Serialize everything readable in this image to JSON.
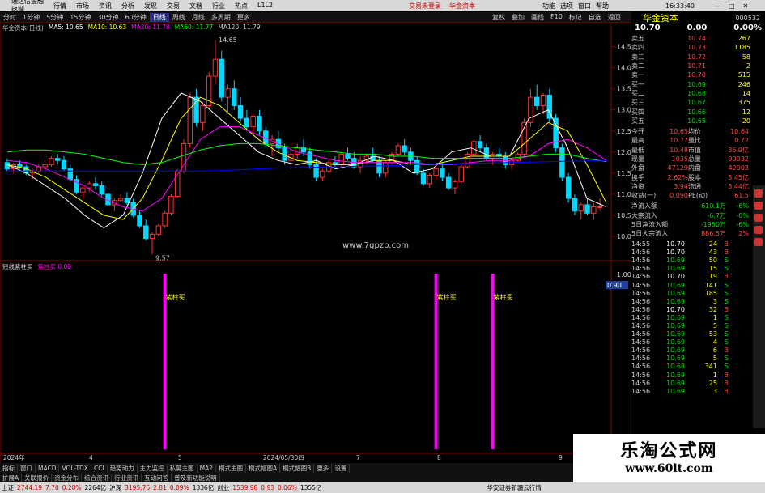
{
  "title_bar": {
    "app_name": "通达信金融终端",
    "menu": [
      "行情",
      "市场",
      "资讯",
      "分析",
      "发现",
      "交易",
      "文档",
      "行业",
      "热点",
      "L1L2"
    ],
    "center_links": [
      "交易未登录",
      "华金资本"
    ],
    "right_items": [
      "功能",
      "选项",
      "窗口",
      "帮助"
    ],
    "time": "16:33:40"
  },
  "toolbar": {
    "periods": [
      "分时",
      "1分钟",
      "5分钟",
      "15分钟",
      "30分钟",
      "60分钟",
      "日线",
      "周线",
      "月线",
      "多周期",
      "更多"
    ],
    "active_period": "日线",
    "right_buttons": [
      "复权",
      "叠加",
      "画线",
      "F10",
      "标记",
      "自选",
      "返回"
    ]
  },
  "main_chart": {
    "title": "华金资本(日线)",
    "ma_labels": [
      {
        "text": "MA5: 10.65",
        "color": "#ffffff"
      },
      {
        "text": "MA10: 10.63",
        "color": "#ffff00"
      },
      {
        "text": "MA20: 11.78",
        "color": "#ff00ff"
      },
      {
        "text": "MA60: 11.77",
        "color": "#00ff00"
      },
      {
        "text": "MA120: 11.79",
        "color": "#cccccc"
      }
    ],
    "price_axis": [
      "14.50",
      "14.00",
      "13.50",
      "13.00",
      "12.50",
      "12.00",
      "11.50",
      "11.00",
      "10.50",
      "10.00"
    ],
    "high_label": "14.65",
    "low_label": "9.57",
    "site_watermark": "www.7gpzb.com"
  },
  "chart_data": {
    "type": "candlestick",
    "ylim": [
      9.5,
      14.8
    ],
    "candles": [
      [
        11.75,
        11.85,
        11.55,
        11.6
      ],
      [
        11.6,
        11.75,
        11.5,
        11.7
      ],
      [
        11.7,
        11.8,
        11.6,
        11.65
      ],
      [
        11.65,
        11.7,
        11.45,
        11.5
      ],
      [
        11.5,
        11.6,
        11.35,
        11.55
      ],
      [
        11.55,
        11.7,
        11.5,
        11.65
      ],
      [
        11.65,
        11.8,
        11.6,
        11.7
      ],
      [
        11.7,
        11.9,
        11.65,
        11.85
      ],
      [
        11.85,
        11.95,
        11.7,
        11.8
      ],
      [
        11.8,
        11.9,
        11.55,
        11.6
      ],
      [
        11.6,
        11.7,
        11.3,
        11.35
      ],
      [
        11.35,
        11.45,
        11.0,
        11.05
      ],
      [
        11.05,
        11.2,
        10.9,
        11.15
      ],
      [
        11.15,
        11.3,
        11.05,
        11.25
      ],
      [
        11.25,
        11.4,
        11.1,
        11.2
      ],
      [
        11.2,
        11.3,
        10.95,
        11.0
      ],
      [
        11.0,
        11.1,
        10.7,
        10.75
      ],
      [
        10.75,
        10.9,
        10.6,
        10.85
      ],
      [
        10.85,
        11.0,
        10.8,
        10.9
      ],
      [
        10.9,
        11.05,
        10.75,
        10.8
      ],
      [
        10.8,
        10.9,
        10.45,
        10.5
      ],
      [
        10.5,
        10.6,
        10.2,
        10.25
      ],
      [
        10.25,
        10.4,
        9.9,
        9.95
      ],
      [
        9.95,
        10.1,
        9.57,
        10.05
      ],
      [
        10.05,
        10.3,
        10.0,
        10.25
      ],
      [
        10.25,
        10.6,
        10.2,
        10.55
      ],
      [
        10.55,
        11.0,
        10.5,
        10.95
      ],
      [
        10.95,
        11.6,
        10.9,
        11.55
      ],
      [
        11.55,
        12.3,
        11.5,
        12.2
      ],
      [
        12.2,
        13.4,
        12.1,
        13.3
      ],
      [
        13.3,
        13.5,
        12.6,
        12.7
      ],
      [
        12.7,
        13.2,
        12.5,
        13.1
      ],
      [
        13.1,
        13.9,
        13.0,
        13.8
      ],
      [
        13.8,
        14.65,
        13.6,
        14.2
      ],
      [
        14.2,
        14.4,
        13.2,
        13.3
      ],
      [
        13.3,
        13.6,
        12.9,
        13.5
      ],
      [
        13.5,
        13.7,
        13.0,
        13.1
      ],
      [
        13.1,
        13.3,
        12.7,
        12.8
      ],
      [
        12.8,
        13.0,
        12.5,
        12.6
      ],
      [
        12.6,
        12.9,
        12.4,
        12.85
      ],
      [
        12.85,
        13.0,
        12.4,
        12.5
      ],
      [
        12.5,
        12.6,
        12.1,
        12.2
      ],
      [
        12.2,
        12.4,
        11.9,
        12.3
      ],
      [
        12.3,
        12.5,
        12.0,
        12.1
      ],
      [
        12.1,
        12.2,
        11.7,
        11.8
      ],
      [
        11.8,
        12.0,
        11.6,
        11.95
      ],
      [
        11.95,
        12.2,
        11.85,
        12.1
      ],
      [
        12.1,
        12.3,
        11.9,
        12.0
      ],
      [
        12.0,
        12.1,
        11.6,
        11.7
      ],
      [
        11.7,
        11.85,
        11.3,
        11.4
      ],
      [
        11.4,
        11.6,
        11.3,
        11.55
      ],
      [
        11.55,
        11.8,
        11.5,
        11.75
      ],
      [
        11.75,
        11.9,
        11.6,
        11.7
      ],
      [
        11.7,
        12.0,
        11.65,
        11.95
      ],
      [
        11.95,
        12.1,
        11.8,
        11.85
      ],
      [
        11.85,
        12.0,
        11.6,
        11.65
      ],
      [
        11.65,
        11.9,
        11.5,
        11.8
      ],
      [
        11.8,
        11.95,
        11.7,
        11.9
      ],
      [
        11.9,
        12.1,
        11.75,
        11.8
      ],
      [
        11.8,
        11.9,
        11.4,
        11.5
      ],
      [
        11.5,
        11.8,
        11.4,
        11.75
      ],
      [
        11.75,
        12.0,
        11.7,
        11.95
      ],
      [
        11.95,
        12.2,
        11.9,
        12.15
      ],
      [
        12.15,
        12.3,
        11.9,
        12.0
      ],
      [
        12.0,
        12.1,
        11.7,
        11.8
      ],
      [
        11.8,
        11.9,
        11.45,
        11.5
      ],
      [
        11.5,
        11.6,
        11.2,
        11.25
      ],
      [
        11.25,
        11.5,
        11.15,
        11.45
      ],
      [
        11.45,
        11.7,
        11.35,
        11.6
      ],
      [
        11.6,
        11.75,
        11.3,
        11.4
      ],
      [
        11.4,
        11.5,
        11.1,
        11.15
      ],
      [
        11.15,
        11.35,
        11.0,
        11.3
      ],
      [
        11.3,
        11.7,
        11.25,
        11.65
      ],
      [
        11.65,
        12.0,
        11.6,
        11.95
      ],
      [
        11.95,
        12.3,
        11.9,
        12.25
      ],
      [
        12.25,
        12.4,
        12.0,
        12.1
      ],
      [
        12.1,
        12.2,
        11.8,
        11.85
      ],
      [
        11.85,
        12.0,
        11.7,
        11.95
      ],
      [
        11.95,
        12.1,
        11.8,
        11.9
      ],
      [
        11.9,
        12.0,
        11.6,
        11.7
      ],
      [
        11.7,
        11.85,
        11.6,
        11.8
      ],
      [
        11.8,
        12.0,
        11.75,
        11.95
      ],
      [
        11.95,
        12.8,
        11.9,
        12.7
      ],
      [
        12.7,
        13.5,
        12.6,
        13.3
      ],
      [
        13.3,
        13.6,
        13.0,
        13.1
      ],
      [
        13.1,
        13.4,
        12.9,
        13.35
      ],
      [
        13.35,
        13.5,
        12.7,
        12.8
      ],
      [
        12.8,
        12.9,
        12.0,
        12.1
      ],
      [
        12.1,
        12.2,
        11.3,
        11.4
      ],
      [
        11.4,
        11.5,
        10.8,
        10.9
      ],
      [
        10.9,
        11.0,
        10.5,
        10.6
      ],
      [
        10.6,
        10.8,
        10.4,
        10.75
      ],
      [
        10.75,
        10.9,
        10.5,
        10.55
      ],
      [
        10.55,
        10.8,
        10.4,
        10.7
      ],
      [
        10.7,
        10.9,
        10.6,
        10.7
      ]
    ],
    "ma_series": [
      {
        "name": "MA5",
        "color": "#ffffff",
        "values": [
          11.7,
          11.5,
          11.2,
          10.9,
          10.5,
          10.2,
          10.5,
          11.5,
          12.8,
          13.4,
          13.2,
          12.8,
          12.4,
          12.0,
          11.8,
          11.7,
          11.8,
          11.6,
          11.7,
          11.9,
          11.8,
          11.5,
          11.6,
          12.0,
          12.1,
          11.9,
          11.9,
          12.8,
          13.0,
          12.1,
          10.9,
          10.7
        ]
      },
      {
        "name": "MA10",
        "color": "#ffff00",
        "values": [
          11.7,
          11.6,
          11.4,
          11.1,
          10.8,
          10.5,
          10.4,
          10.9,
          11.8,
          12.8,
          13.3,
          13.1,
          12.7,
          12.3,
          12.0,
          11.8,
          11.75,
          11.7,
          11.7,
          11.8,
          11.8,
          11.7,
          11.7,
          11.8,
          11.9,
          11.9,
          11.9,
          12.3,
          12.7,
          12.5,
          11.7,
          10.8
        ]
      },
      {
        "name": "MA20",
        "color": "#ff00ff",
        "values": [
          11.8,
          11.75,
          11.6,
          11.4,
          11.2,
          10.9,
          10.7,
          10.6,
          10.9,
          11.6,
          12.3,
          12.6,
          12.6,
          12.4,
          12.2,
          12.0,
          11.9,
          11.8,
          11.75,
          11.75,
          11.75,
          11.75,
          11.7,
          11.7,
          11.75,
          11.8,
          11.8,
          11.9,
          12.2,
          12.3,
          12.1,
          11.8
        ]
      },
      {
        "name": "MA60",
        "color": "#00ff00",
        "values": [
          12.0,
          12.05,
          12.05,
          12.0,
          11.95,
          11.85,
          11.75,
          11.7,
          11.75,
          11.9,
          12.05,
          12.15,
          12.2,
          12.2,
          12.15,
          12.1,
          12.05,
          12.0,
          11.95,
          11.95,
          11.9,
          11.9,
          11.85,
          11.85,
          11.85,
          11.85,
          11.85,
          11.9,
          11.95,
          11.95,
          11.85,
          11.77
        ]
      },
      {
        "name": "MA120",
        "color": "#0000ff",
        "values": [
          11.55,
          11.55,
          11.55,
          11.55,
          11.55,
          11.55,
          11.55,
          11.55,
          11.55,
          11.55,
          11.55,
          11.56,
          11.58,
          11.6,
          11.62,
          11.63,
          11.64,
          11.65,
          11.66,
          11.67,
          11.68,
          11.7,
          11.71,
          11.72,
          11.73,
          11.74,
          11.75,
          11.76,
          11.77,
          11.78,
          11.79,
          11.79
        ]
      }
    ],
    "signal_bars_index": [
      25,
      68,
      77
    ]
  },
  "sub_chart": {
    "title": "短线紫柱买",
    "subtitle": "紫柱买 0.00",
    "bar_label": "紫柱买",
    "axis_top": "1.00",
    "axis_value": "0.90"
  },
  "date_axis": [
    "2024年",
    "4",
    "5",
    "2024/05/30四",
    "7",
    "8",
    "9"
  ],
  "bottom_tabs": [
    "指标",
    "窗口",
    "MACD",
    "VOL-TDX",
    "CCI",
    "趋势动力",
    "主力监控",
    "私募主图",
    "MA2",
    "桐式主图",
    "桐式幅图A",
    "桐式幅图B",
    "更多",
    "设置"
  ],
  "quote": {
    "name": "华金资本",
    "code": "000532",
    "price": "10.70",
    "change": "0.00",
    "pct": "0.00%",
    "asks": [
      [
        "卖五",
        "10.74",
        "267"
      ],
      [
        "卖四",
        "10.73",
        "1185"
      ],
      [
        "卖三",
        "10.72",
        "58"
      ],
      [
        "卖二",
        "10.71",
        "2"
      ],
      [
        "卖一",
        "10.70",
        "515"
      ]
    ],
    "bids": [
      [
        "买一",
        "10.69",
        "246"
      ],
      [
        "买二",
        "10.68",
        "14"
      ],
      [
        "买三",
        "10.67",
        "375"
      ],
      [
        "买四",
        "10.66",
        "12"
      ],
      [
        "买五",
        "10.65",
        "20"
      ]
    ],
    "stats": [
      [
        "今开",
        "10.65",
        "均价",
        "10.64"
      ],
      [
        "最高",
        "10.77",
        "量比",
        "0.72"
      ],
      [
        "最低",
        "10.49",
        "市值",
        "36.9亿"
      ],
      [
        "现量",
        "1035",
        "总量",
        "90032"
      ],
      [
        "外盘",
        "47129",
        "内盘",
        "42903"
      ],
      [
        "换手",
        "2.62%",
        "股本",
        "3.45亿"
      ],
      [
        "净资",
        "3.94",
        "流通",
        "3.44亿"
      ],
      [
        "收益(一)",
        "0.090",
        "PE(动)",
        "61.5"
      ]
    ],
    "flows": [
      [
        "净流入额",
        "-610.1万",
        "-6%"
      ],
      [
        "大宗流入",
        "-6.7万",
        "-0%"
      ],
      [
        "5日净流入额",
        "-1950万",
        "-6%"
      ],
      [
        "5日大宗流入",
        "886.5万",
        "2%"
      ]
    ],
    "ticks": [
      [
        "14:55",
        "10.70",
        "24",
        "B"
      ],
      [
        "14:56",
        "10.70",
        "43",
        "B"
      ],
      [
        "14:56",
        "10.69",
        "50",
        "S"
      ],
      [
        "14:56",
        "10.69",
        "15",
        "S"
      ],
      [
        "14:56",
        "10.70",
        "19",
        "B"
      ],
      [
        "14:56",
        "10.69",
        "141",
        "S"
      ],
      [
        "14:56",
        "10.69",
        "185",
        "S"
      ],
      [
        "14:56",
        "10.69",
        "3",
        "S"
      ],
      [
        "14:56",
        "10.70",
        "32",
        "B"
      ],
      [
        "14:56",
        "10.69",
        "1",
        "S"
      ],
      [
        "14:56",
        "10.69",
        "5",
        "S"
      ],
      [
        "14:56",
        "10.69",
        "53",
        "S"
      ],
      [
        "14:56",
        "10.69",
        "4",
        "S"
      ],
      [
        "14:56",
        "10.69",
        "6",
        "B"
      ],
      [
        "14:56",
        "10.69",
        "5",
        "S"
      ],
      [
        "14:56",
        "10.68",
        "341",
        "S"
      ],
      [
        "14:56",
        "10.69",
        "1",
        "B"
      ],
      [
        "14:56",
        "10.69",
        "25",
        "B"
      ],
      [
        "14:56",
        "10.69",
        "3",
        "B"
      ]
    ]
  },
  "status_bar": {
    "items": [
      {
        "label": "上证",
        "value": "2744.19",
        "chg": "7.70",
        "pct": "0.28%",
        "vol": "2264亿"
      },
      {
        "label": "沪深",
        "value": "3195.76",
        "chg": "2.81",
        "pct": "0.09%",
        "vol": "1336亿"
      },
      {
        "label": "创业",
        "value": "1539.98",
        "chg": "0.93",
        "pct": "0.06%",
        "vol": "1355亿"
      }
    ],
    "server": "华安证券新疆云行情"
  },
  "left_tabs": [
    "扩展A",
    "关联报价",
    "资金分布",
    "综合资讯",
    "行业资讯",
    "互动问答",
    "普及新功能说明"
  ],
  "watermark": {
    "line1": "乐淘公式网",
    "line2": "www.60lt.com"
  }
}
